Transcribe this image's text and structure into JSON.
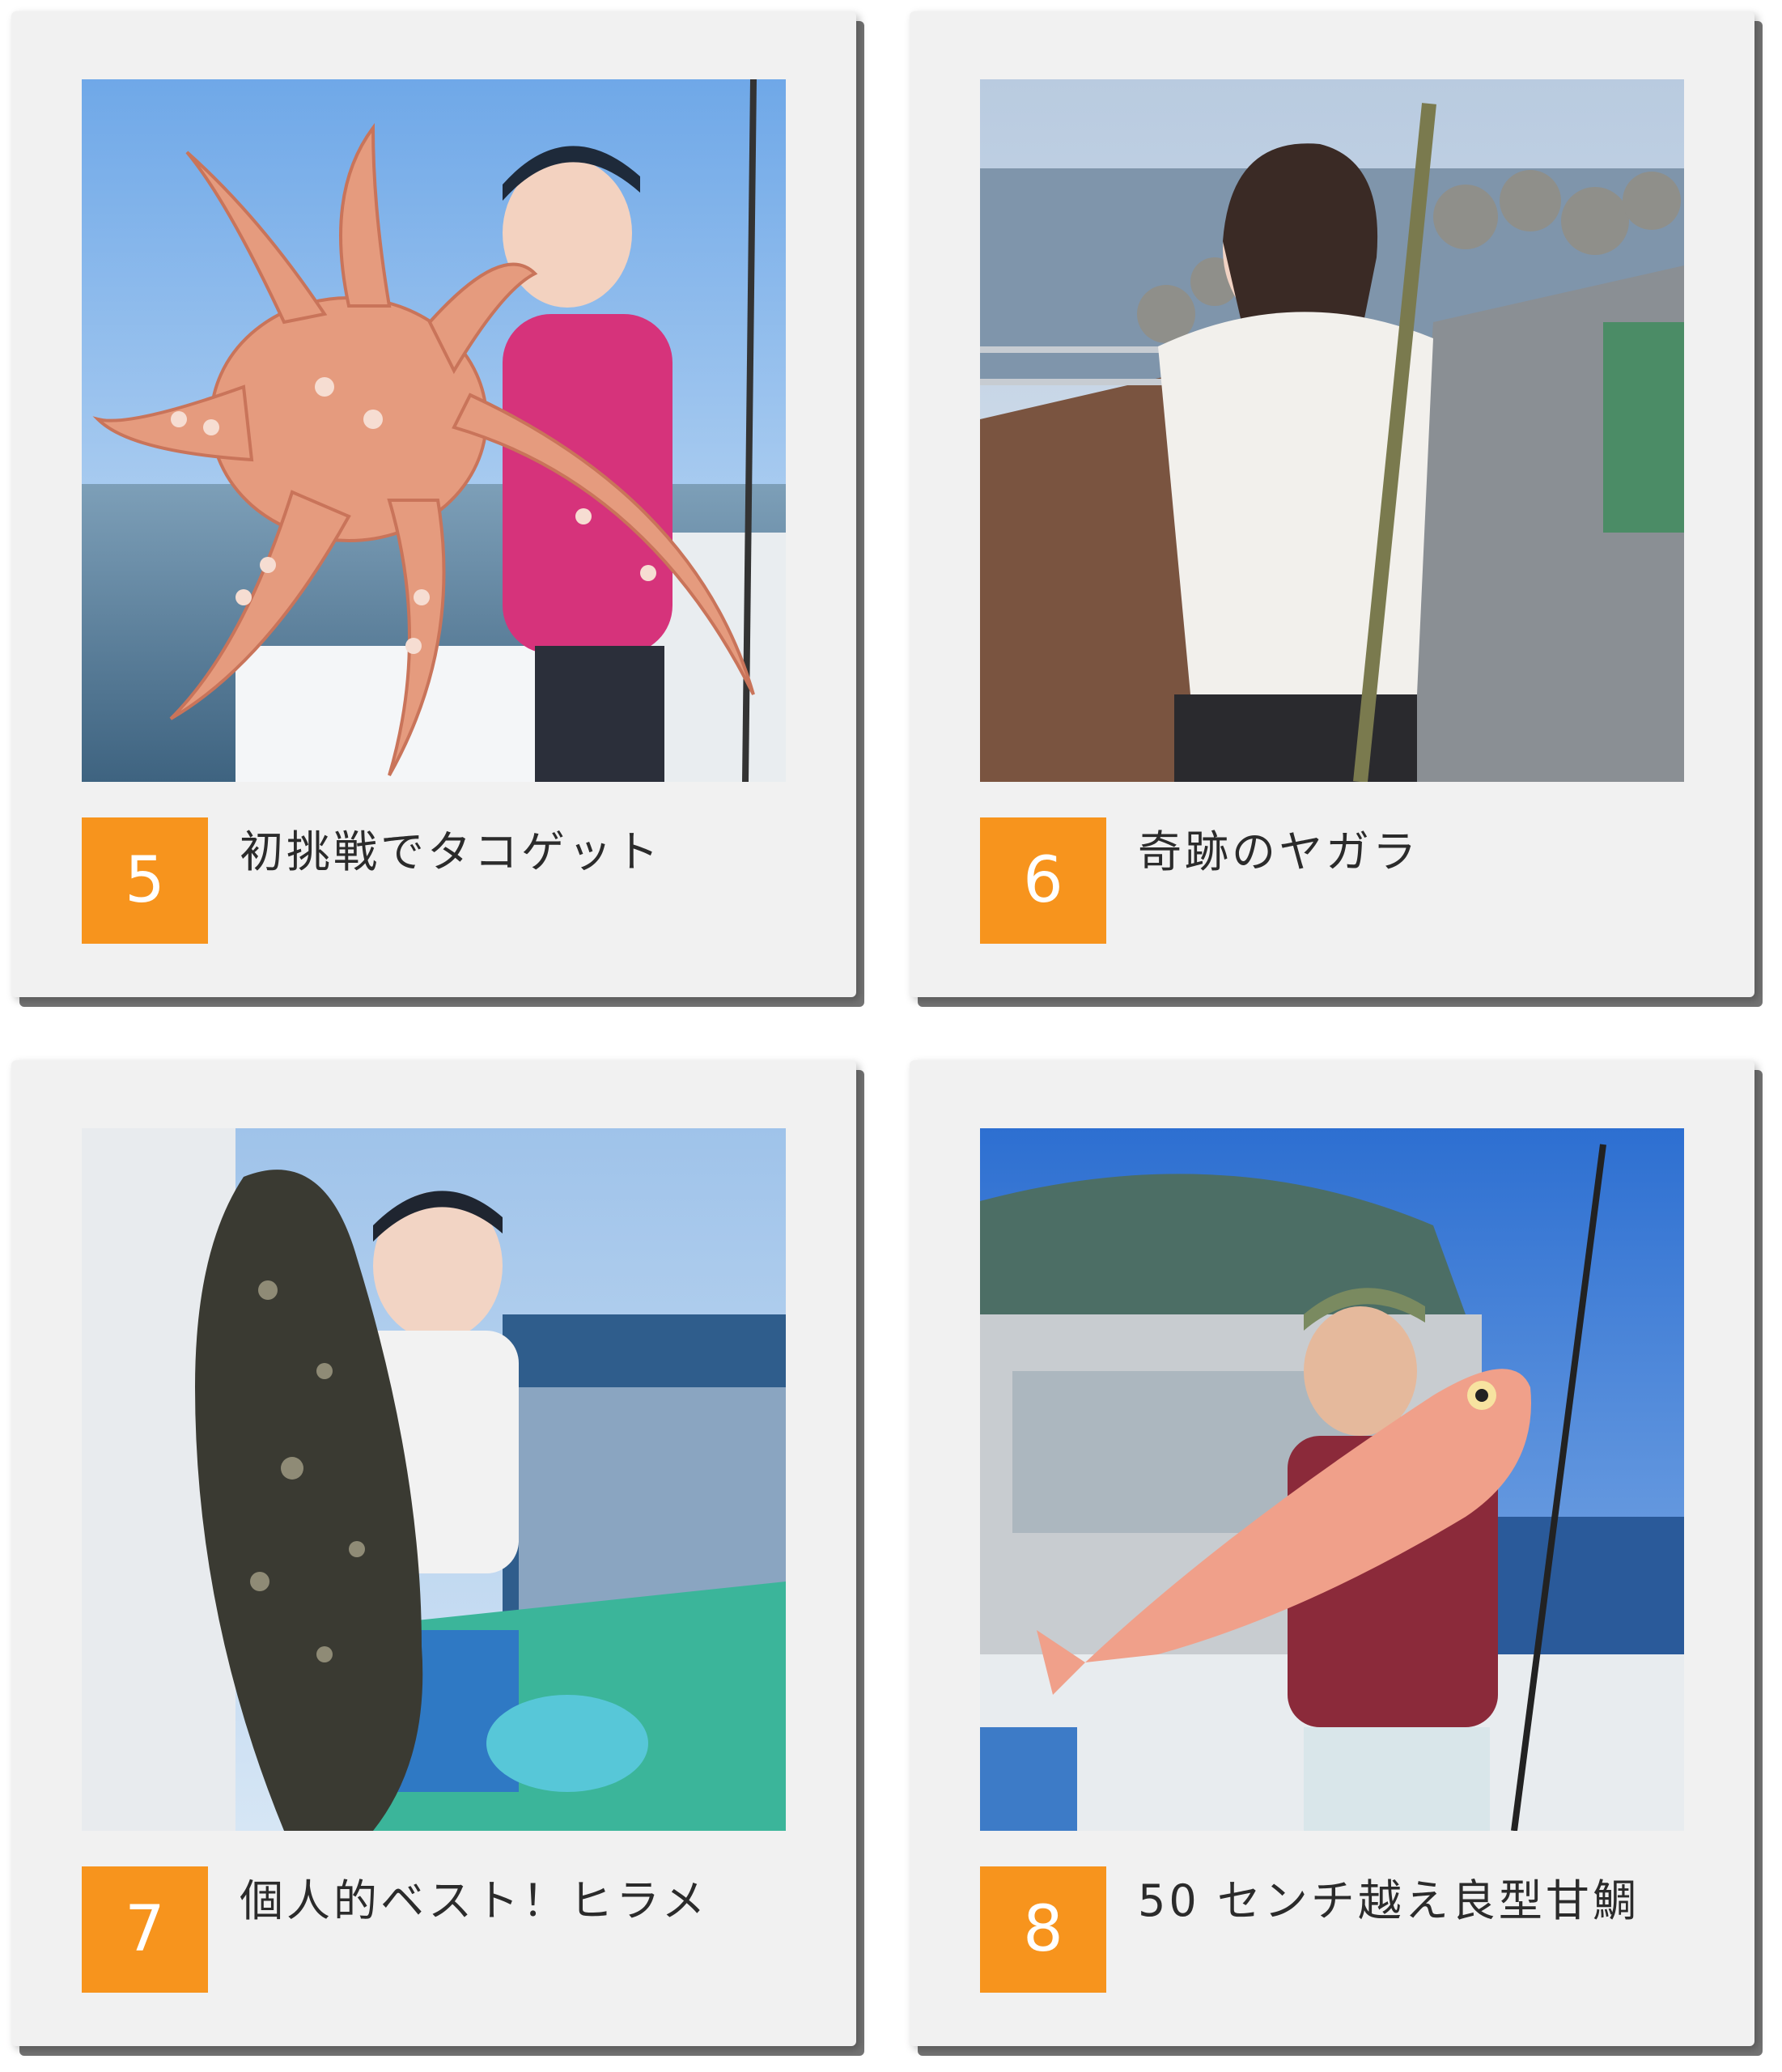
{
  "accent_color": "#f7941d",
  "cards": [
    {
      "number": "5",
      "caption": "初挑戦でタコゲット",
      "photo_icon": "octopus-catch-photo"
    },
    {
      "number": "6",
      "caption": "奇跡のヤガラ",
      "photo_icon": "cornetfish-catch-photo"
    },
    {
      "number": "7",
      "caption": "個人的ベスト！ヒラメ",
      "photo_icon": "flounder-catch-photo"
    },
    {
      "number": "8",
      "caption": "50 センチ越え良型甘鯛",
      "photo_icon": "tilefish-catch-photo"
    }
  ]
}
